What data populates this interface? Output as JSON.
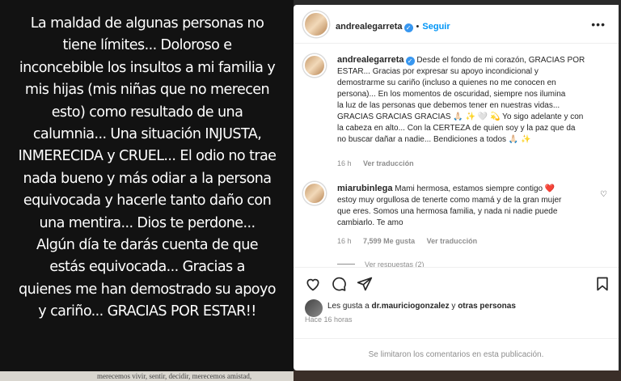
{
  "story": {
    "lines": [
      "La maldad de algunas personas no",
      "tiene límites... Doloroso e",
      "inconcebible los insultos a mi familia y",
      "mis hijas (mis niñas que no merecen",
      "esto) como resultado de una",
      "calumnia... Una situación INJUSTA,",
      "INMERECIDA y CRUEL... El odio no trae",
      "nada bueno y más odiar a la persona",
      "equivocada y hacerle tanto daño con",
      "una mentira... Dios te perdone...",
      "Algún día te darás cuenta de que",
      "estás equivocada... Gracias  a",
      "quienes me han demostrado su apoyo",
      "y cariño... GRACIAS POR ESTAR!!"
    ],
    "paper_text": "merecemos vivir, sentir, decidir, merecemos amistad,"
  },
  "post": {
    "author": "andrealegarreta",
    "follow_label": "Seguir",
    "caption": {
      "username": "andrealegarreta",
      "lines": [
        "Desde el fondo de mi corazón, GRACIAS POR",
        "ESTAR... Gracias por expresar su apoyo incondicional y",
        "demostrarme su cariño (incluso a quienes no me conocen en",
        "persona)... En los momentos de oscuridad, siempre nos ilumina",
        "la luz de las personas que debemos tener en nuestras vidas...",
        "GRACIAS GRACIAS GRACIAS 🙏🏻 ✨ 🤍 💫  Yo sigo adelante y con",
        "la cabeza en alto... Con la CERTEZA de quien soy y la paz que da",
        "no buscar dañar a nadie... Bendiciones a todos 🙏🏻 ✨"
      ],
      "time": "16 h",
      "translate": "Ver traducción"
    },
    "comment": {
      "username": "miarubinlega",
      "lines": [
        "Mami hermosa, estamos siempre contigo ❤️",
        "estoy muy orgullosa de tenerte como mamá y de la gran mujer",
        "que eres. Somos una hermosa familia, y nada ni nadie puede",
        "cambiarlo. Te amo"
      ],
      "time": "16 h",
      "likes": "7,599 Me gusta",
      "translate": "Ver traducción",
      "view_replies": "Ver respuestas (2)"
    },
    "liked_by_prefix": "Les gusta a ",
    "liked_by_user": "dr.mauriciogonzalez",
    "liked_by_suffix": " y ",
    "liked_by_others": "otras personas",
    "time_ago": "Hace 16 horas",
    "comments_disabled": "Se limitaron los comentarios en esta publicación.",
    "icons": [
      "heart-icon",
      "comment-icon",
      "share-icon",
      "bookmark-icon",
      "more-icon",
      "verified-icon"
    ]
  },
  "colors": {
    "accent": "#0095f6",
    "verified": "#3897f0",
    "heart": "#ed4956"
  }
}
